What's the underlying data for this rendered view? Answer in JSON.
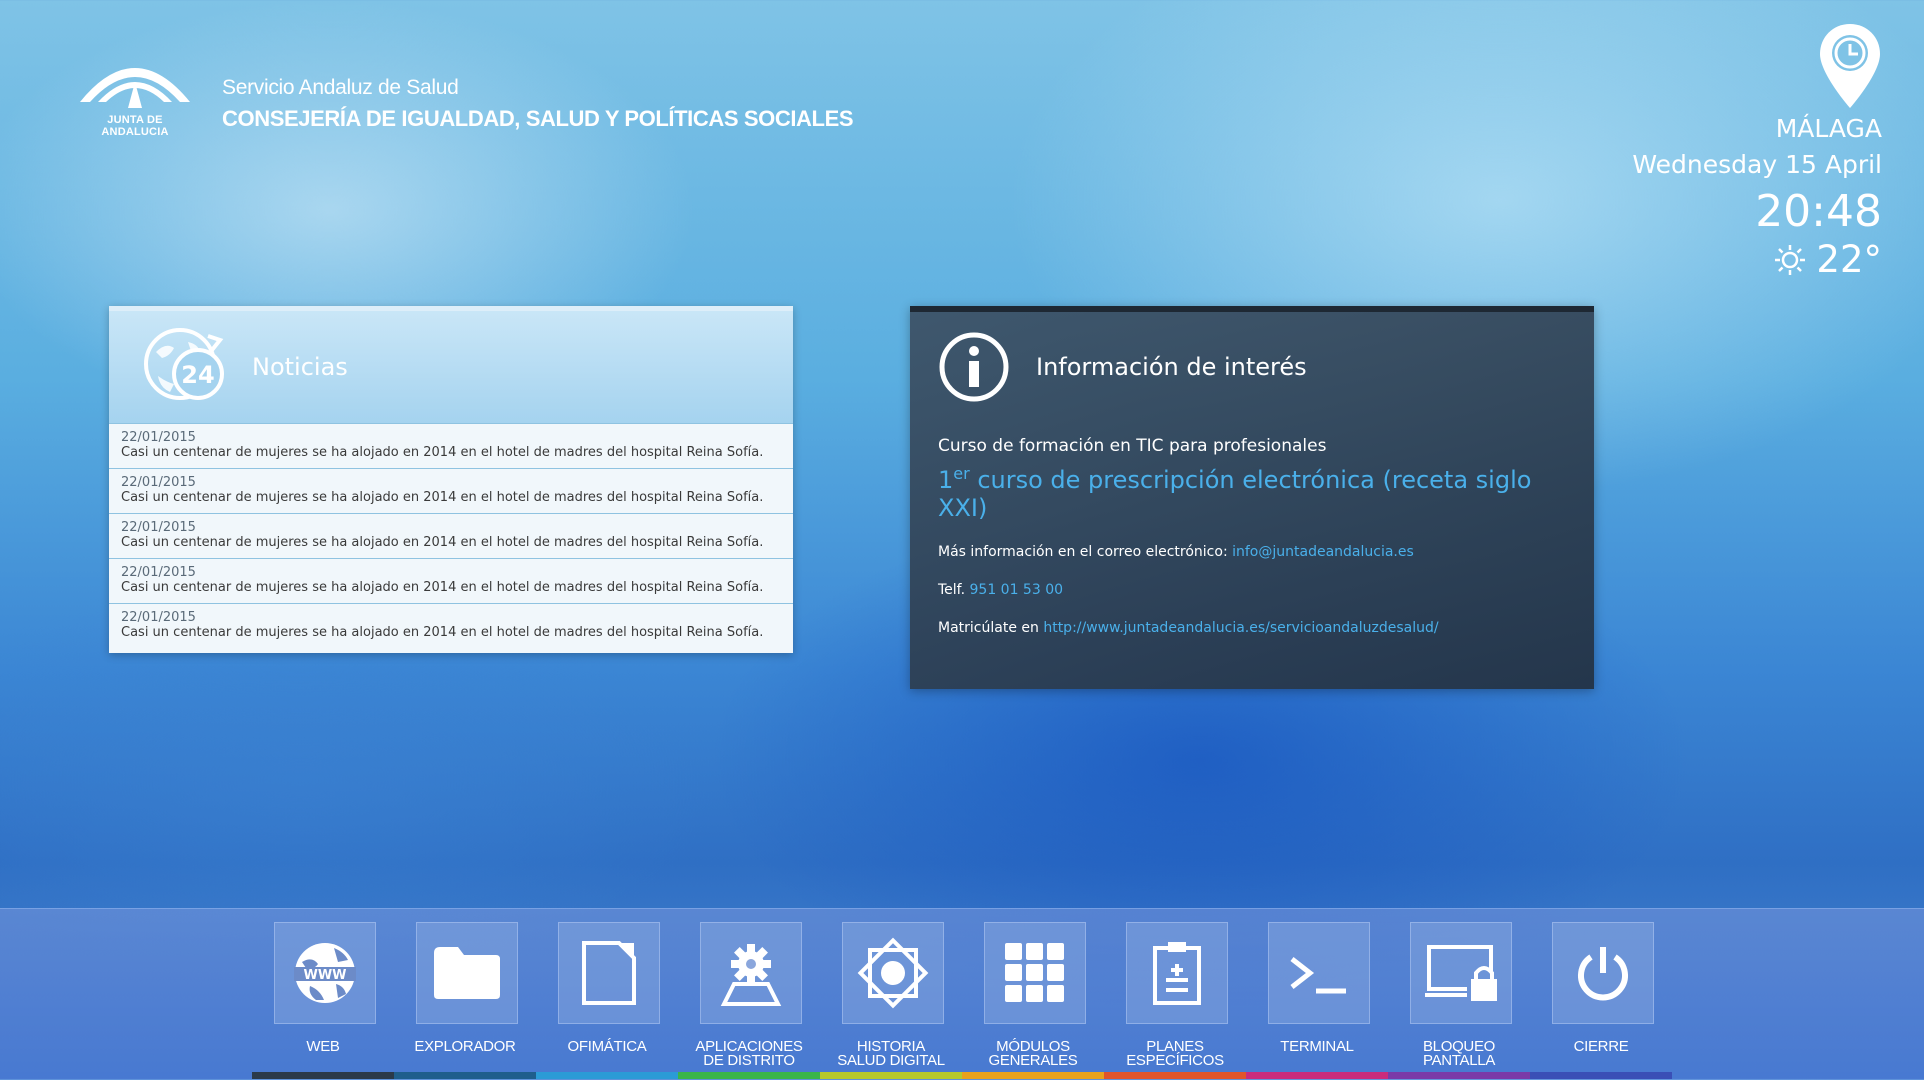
{
  "header": {
    "logo_text": "JUNTA DE ANDALUCIA",
    "subtitle": "Servicio Andaluz de Salud",
    "title": "CONSEJERÍA DE IGUALDAD, SALUD Y POLÍTICAS SOCIALES"
  },
  "weather": {
    "city": "MÁLAGA",
    "date": "Wednesday 15 April",
    "time": "20:48",
    "temperature": "22°",
    "icon": "sun-icon"
  },
  "news": {
    "title": "Noticias",
    "icon": "news-24-icon",
    "items": [
      {
        "date": "22/01/2015",
        "text": "Casi un centenar de mujeres se ha alojado en 2014 en el hotel de madres del hospital Reina Sofía."
      },
      {
        "date": "22/01/2015",
        "text": "Casi un centenar de mujeres se ha alojado en 2014 en el hotel de madres del hospital Reina Sofía."
      },
      {
        "date": "22/01/2015",
        "text": "Casi un centenar de mujeres se ha alojado en 2014 en el hotel de madres del hospital Reina Sofía."
      },
      {
        "date": "22/01/2015",
        "text": "Casi un centenar de mujeres se ha alojado en 2014 en el hotel de madres del hospital Reina Sofía."
      },
      {
        "date": "22/01/2015",
        "text": "Casi un centenar de mujeres se ha alojado en 2014 en el hotel de madres del hospital Reina Sofía."
      }
    ]
  },
  "info": {
    "title": "Información de interés",
    "course_label": "Curso de formación en TIC para profesionales",
    "course_link_num": "1",
    "course_link_sup": "er",
    "course_link_rest": " curso de prescripción electrónica (receta siglo XXI)",
    "email_label": "Más información en el correo electrónico: ",
    "email": "info@juntadeandalucia.es",
    "phone_label": "Telf. ",
    "phone": "951 01 53 00",
    "enroll_label": "Matricúlate en ",
    "enroll_url": "http://www.juntadeandalucia.es/servicioandaluzdesalud/"
  },
  "apps": [
    {
      "label": "WEB",
      "icon": "globe-www-icon",
      "color": "#2b3a4a"
    },
    {
      "label": "EXPLORADOR",
      "icon": "folder-icon",
      "color": "#1f5e8c"
    },
    {
      "label": "OFIMÁTICA",
      "icon": "document-icon",
      "color": "#2b9bd6"
    },
    {
      "label": "APLICACIONES\nDE DISTRITO",
      "icon": "gear-map-icon",
      "color": "#3ab54a"
    },
    {
      "label": "HISTORIA\nSALUD DIGITAL",
      "icon": "health-star-icon",
      "color": "#b6c92c"
    },
    {
      "label": "MÓDULOS\nGENERALES",
      "icon": "grid-icon",
      "color": "#e8a21d"
    },
    {
      "label": "PLANES\nESPECÍFICOS",
      "icon": "clipboard-icon",
      "color": "#e0552b"
    },
    {
      "label": "TERMINAL",
      "icon": "terminal-icon",
      "color": "#c92c7c"
    },
    {
      "label": "BLOQUEO\nPANTALLA",
      "icon": "lock-screen-icon",
      "color": "#7a3aa8"
    },
    {
      "label": "CIERRE",
      "icon": "power-icon",
      "color": "#3a4fb6"
    }
  ]
}
